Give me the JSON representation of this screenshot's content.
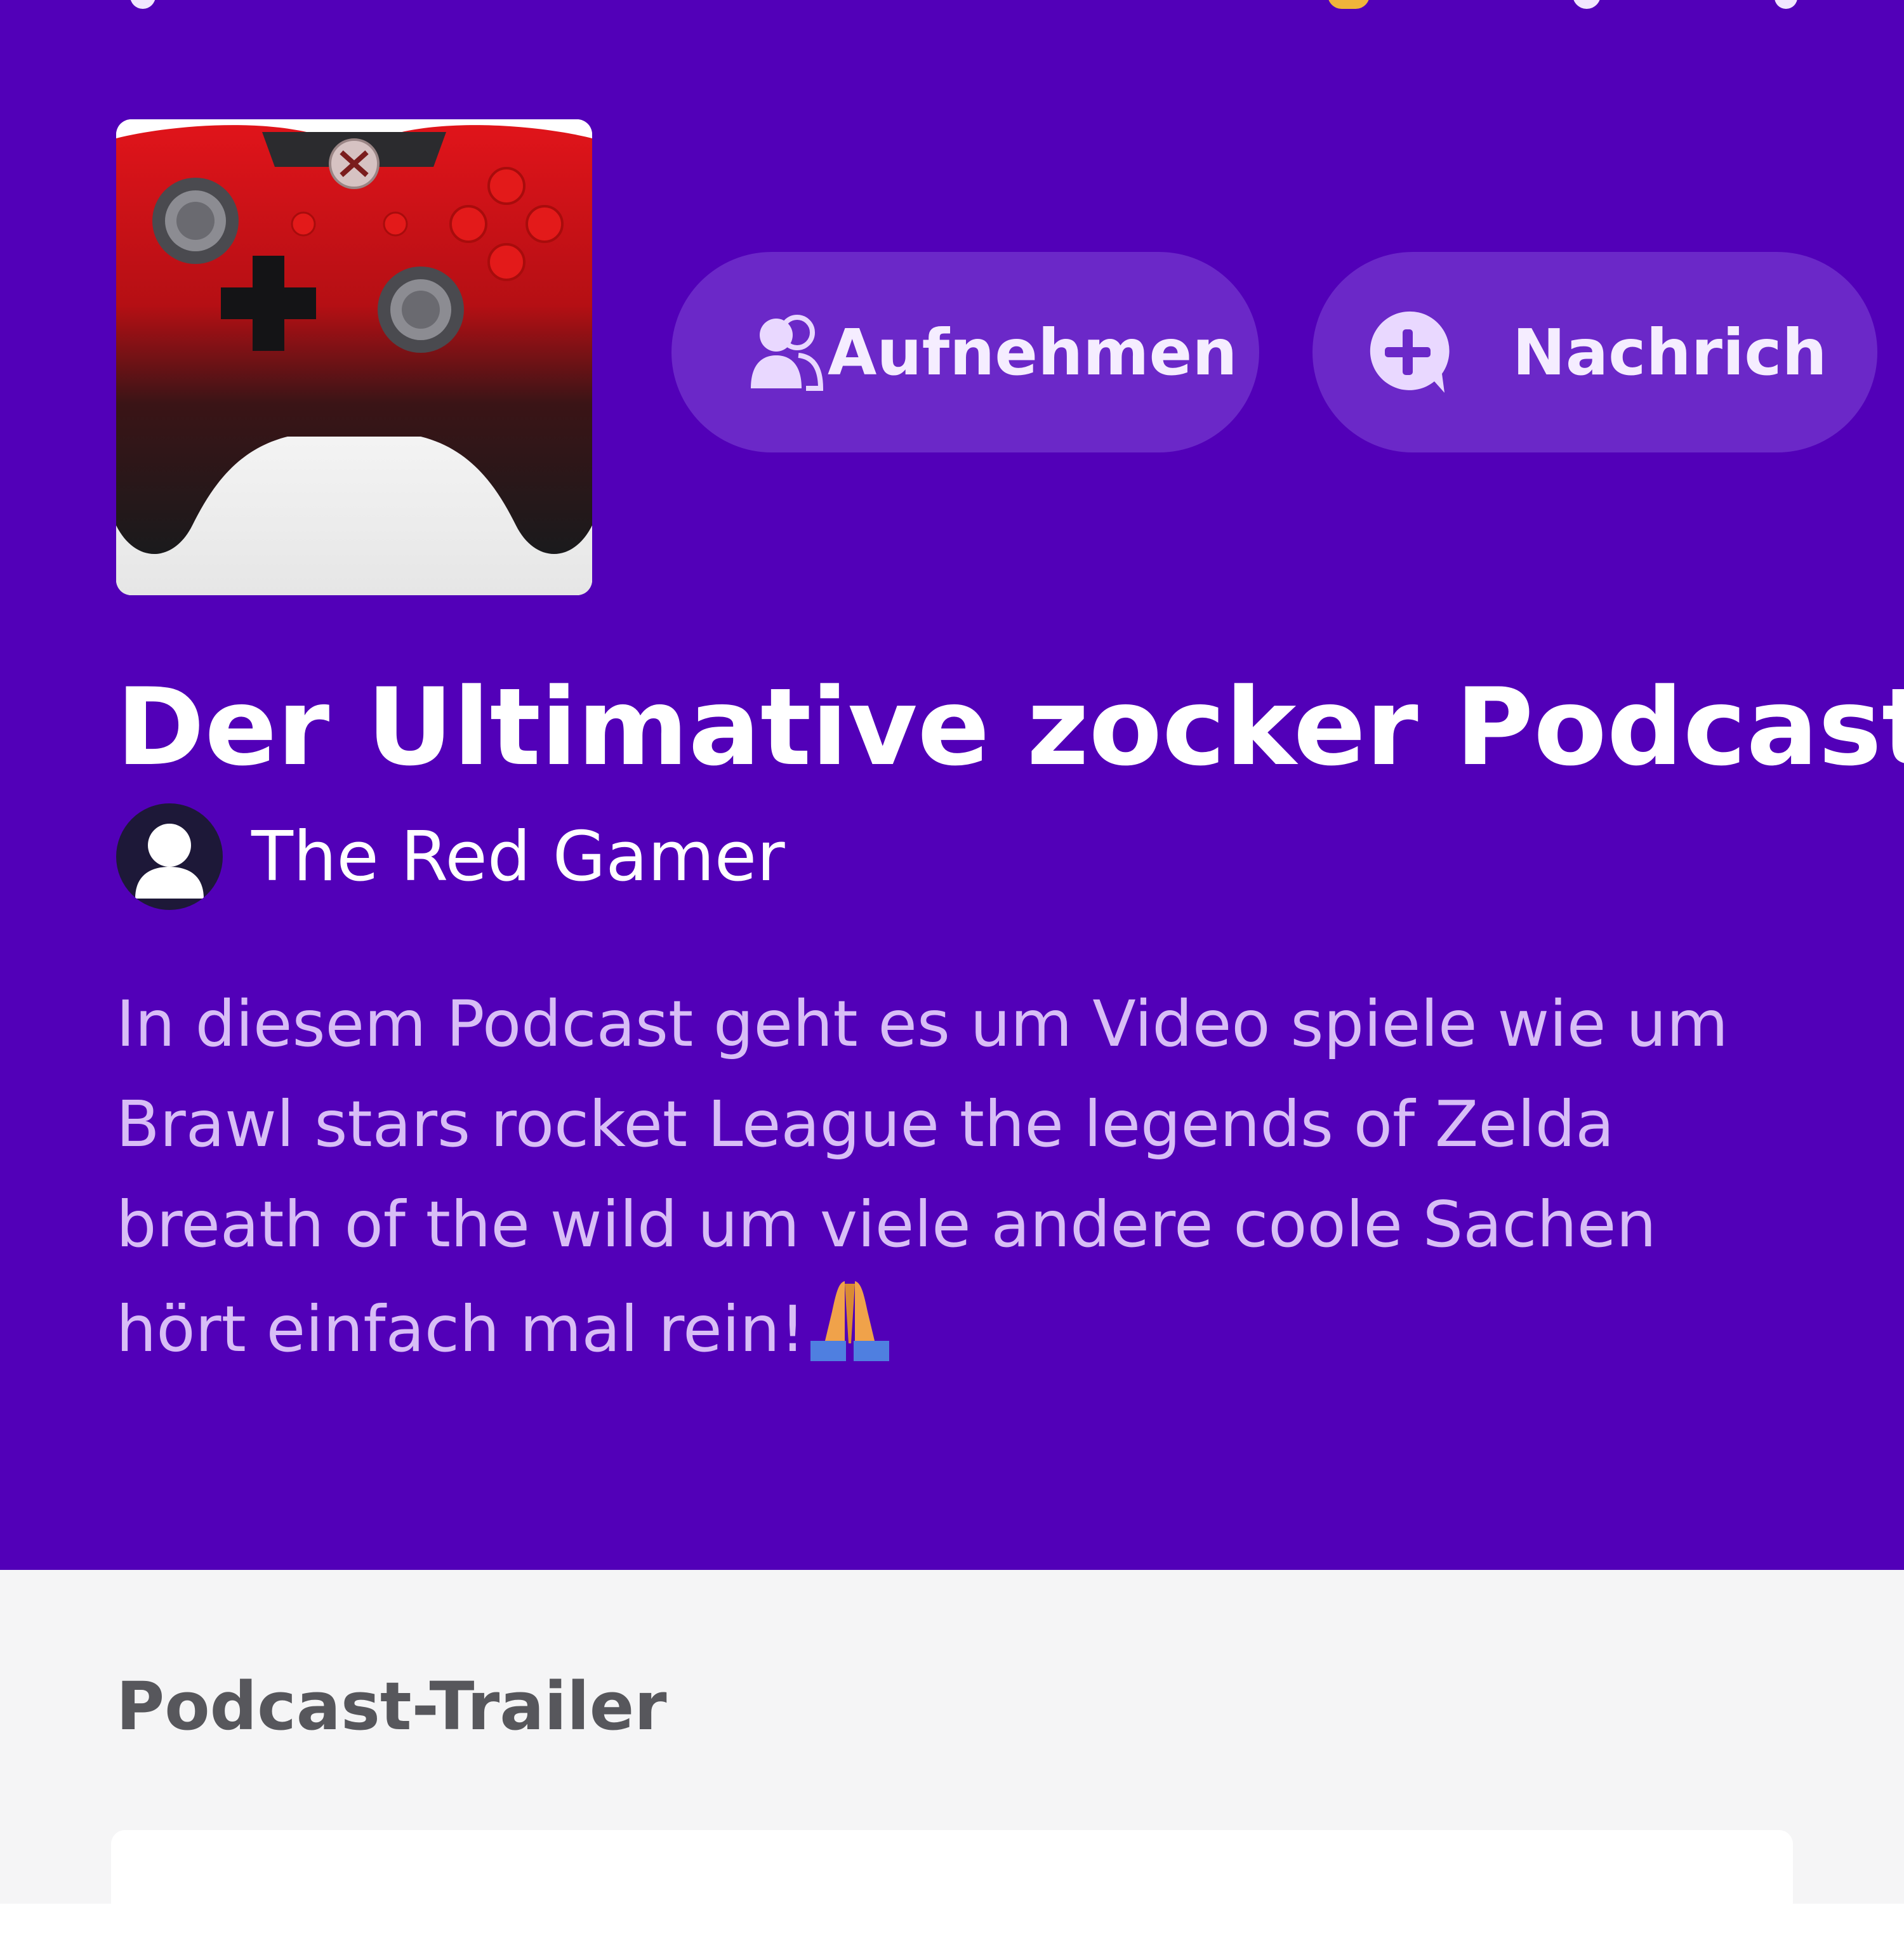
{
  "colors": {
    "header_background": "#5200B8",
    "button_background": "#6B28C8",
    "title_text": "#ffffff",
    "description_text": "#d8bdf6",
    "content_background": "#f5f5f6",
    "section_title_text": "#57575c"
  },
  "topbar": {
    "icons": [
      "back-arrow-icon",
      "star-icon",
      "share-icon",
      "more-vertical-icon"
    ]
  },
  "podcast": {
    "cover_icon": "game-controller-image",
    "title": "Der Ultimative zocker Podcast",
    "author": "The Red Gamer",
    "author_avatar_icon": "user-avatar-icon",
    "description": "In diesem Podcast geht es um Video spiele wie um Brawl stars rocket League the legends of Zelda breath of the wild um viele andere coole Sachen hört einfach mal rein!",
    "description_emoji": "folded-hands-emoji"
  },
  "actions": {
    "record_label": "Aufnehmen",
    "record_icon": "people-record-icon",
    "message_label": "Nachrich",
    "message_icon": "add-message-icon"
  },
  "trailer": {
    "section_title": "Podcast-Trailer"
  }
}
